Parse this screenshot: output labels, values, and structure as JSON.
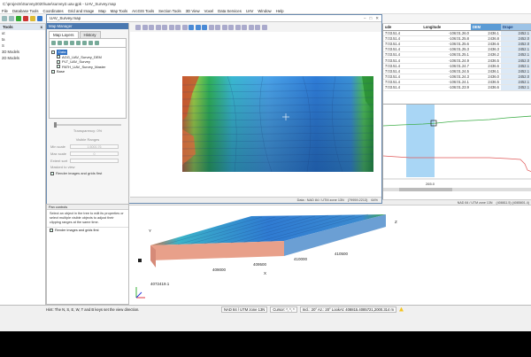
{
  "app": {
    "title": "C:\\projects\\Survey2020\\uav\\survey2.uav.gpk - UAV_Survey.map",
    "menu": [
      "File",
      "Database Tools",
      "Coordinates",
      "Grid and Image",
      "Map",
      "Map Tools",
      "ArcGIS Tools",
      "Section Tools",
      "3D View",
      "Voxel",
      "Data Services",
      "UAV",
      "Window",
      "Help"
    ]
  },
  "left_panel": {
    "header": "Tools",
    "close_glyph": "x",
    "items": [
      "ut",
      "ta",
      "S",
      "3D Models",
      "2D Models"
    ]
  },
  "map_window": {
    "title": "UAV_Survey.map",
    "manager_title": "Map Manager",
    "tabs": [
      "Map Layers",
      "History"
    ],
    "tree": [
      {
        "label": "Data",
        "selected": true
      },
      {
        "label": "AGG_UAV_Survey_DEM",
        "selected": false
      },
      {
        "label": "PLT_UAV_Survey",
        "selected": false
      },
      {
        "label": "PATH_UAV_Survey_Master",
        "selected": false
      },
      {
        "label": "Base",
        "selected": false
      }
    ],
    "props": {
      "transparency_label": "Transparency: 0%",
      "visible_label": "Visible Ranges",
      "min_scale_label": "Min scale",
      "min_scale_value": "1:5000.76",
      "max_scale_label": "Max scale",
      "max_scale_value": "0",
      "extent_label": "Extent sort",
      "masked_label": "Masked to view",
      "render_label": "Render images and grids first"
    },
    "status": {
      "datum": "Data  :  NAD 84 / UTM zone 13N",
      "coord": "(79959.2213)",
      "zoom": "64%"
    }
  },
  "sheet": {
    "headers": [
      "ude",
      "Longitude",
      "DEM",
      "Drape"
    ],
    "rows": [
      [
        "7:03.51.4",
        "-106:01.26.0",
        "2436.1",
        "2452.1"
      ],
      [
        "7:03.51.4",
        "-106:01.25.8",
        "2436.8",
        "2452.0"
      ],
      [
        "7:03.51.4",
        "-106:01.25.6",
        "2436.6",
        "2452.0"
      ],
      [
        "7:03.51.4",
        "-106:01.25.3",
        "2436.3",
        "2452.1"
      ],
      [
        "7:03.51.4",
        "-106:01.25.1",
        "2436.2",
        "2452.1"
      ],
      [
        "7:03.51.4",
        "-106:01.24.9",
        "2436.5",
        "2452.0"
      ],
      [
        "7:03.51.4",
        "-106:01.24.7",
        "2436.6",
        "2452.1"
      ],
      [
        "7:03.51.4",
        "-106:01.24.5",
        "2436.1",
        "2452.1"
      ],
      [
        "7:03.51.4",
        "-106:01.24.3",
        "2436.0",
        "2452.0"
      ],
      [
        "7:03.51.4",
        "-106:01.24.1",
        "2436.5",
        "2452.1"
      ],
      [
        "7:03.51.4",
        "-106:01.23.9",
        "2436.6",
        "2452.1"
      ]
    ]
  },
  "profile": {
    "tick": "265.0",
    "status": "NAD 84 / UTM zone 13N",
    "coord": "(408811.5) (4085801.4)"
  },
  "lower_left": {
    "header": "Pan controls",
    "help_text": "Select an object in the tree to edit its properties or select multiple visible objects to adjust their clipping ranges at the same time.",
    "checkbox_label": "Render images and grids first"
  },
  "view3d": {
    "ticks_x": [
      "409000",
      "409500",
      "410000",
      "410500"
    ],
    "tick_corner": "4072419.1",
    "axis_letters": [
      "X",
      "Y",
      "Z"
    ]
  },
  "statusbar": {
    "hint": "Hint: The N, S, E, W, T and B keys set the view direction.",
    "datum": "NAD 84 / UTM zone 13N",
    "cursor": "Cursor: *, *, *",
    "angle": "Incl.: 20°   Az.: 20°   LookAt: 408815.4085721,2000.314 m"
  }
}
